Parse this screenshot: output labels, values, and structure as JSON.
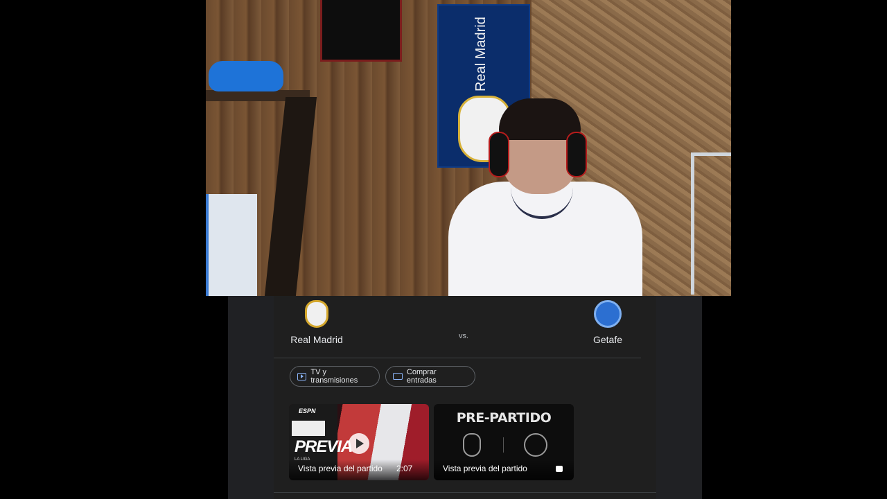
{
  "webcam": {
    "flag_text": "Real Madrid"
  },
  "match": {
    "home_team": "Real Madrid",
    "away_team": "Getafe",
    "vs_label": "vs.",
    "home_crest": "real-madrid-crest-icon",
    "away_crest": "getafe-crest-icon"
  },
  "actions": {
    "tv_label": "TV y transmisiones",
    "tickets_label": "Comprar entradas"
  },
  "videos": [
    {
      "overlay_brand": "ESPN",
      "overlay_title": "PREVIA",
      "overlay_sub": "LA LIGA",
      "caption": "Vista previa del partido",
      "duration": "2:07"
    },
    {
      "overlay_title": "PRE-PARTIDO",
      "caption": "Vista previa del partido"
    }
  ],
  "colors": {
    "panel_bg": "#202124",
    "accent": "#8ab4f8",
    "text": "#e8eaed"
  }
}
